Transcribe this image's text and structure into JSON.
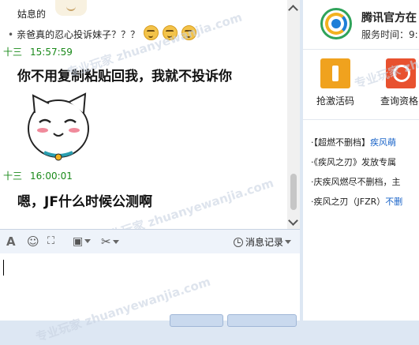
{
  "chat": {
    "prev_line1": "姑息的",
    "prev_line2": "亲爸真的忍心投诉妹子？？？",
    "messages": [
      {
        "sender": "十三",
        "time": "15:57:59",
        "text": "你不用复制粘贴回我，我就不投诉你"
      },
      {
        "sender": "十三",
        "time": "16:00:01",
        "text": "嗯，JF什么时候公测啊"
      }
    ],
    "watermark": "专业玩家 zhuanyewanjia.com"
  },
  "toolbar": {
    "font_icon": "A",
    "history_label": "消息记录"
  },
  "right_panel": {
    "official_name": "腾讯官方在",
    "service_time": "服务时间：9:",
    "apps": [
      {
        "icon": "report-icon",
        "label": "抢激活码"
      },
      {
        "icon": "query-icon",
        "label": "查询资格"
      }
    ],
    "news": [
      {
        "prefix": "·【超燃不删档】",
        "link": "疾风萌"
      },
      {
        "prefix": "·《疾风之刃》发放专属",
        "link": ""
      },
      {
        "prefix": "·庆疾风燃尽不删档，主",
        "link": ""
      },
      {
        "prefix": "·疾风之刃（JFZR）",
        "link": "不删"
      }
    ]
  },
  "colors": {
    "accent": "#1a8a1a",
    "link": "#1a64c8",
    "panel_bg": "#dde7f3"
  }
}
